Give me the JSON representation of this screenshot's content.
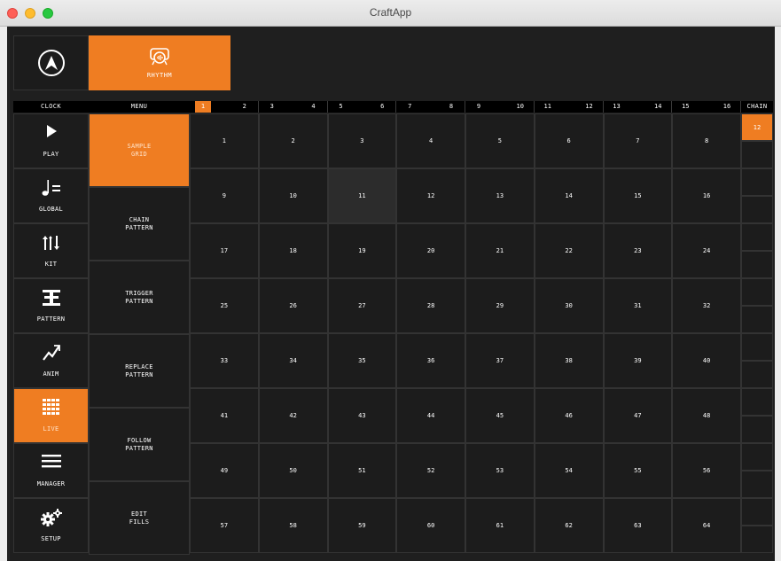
{
  "window": {
    "title": "CraftApp"
  },
  "top": {
    "rhythm_label": "RHYTHM"
  },
  "header": {
    "clock": "CLOCK",
    "menu": "MENU",
    "chain": "CHAIN"
  },
  "sequence": [
    [
      "1",
      "2"
    ],
    [
      "3",
      "4"
    ],
    [
      "5",
      "6"
    ],
    [
      "7",
      "8"
    ],
    [
      "9",
      "10"
    ],
    [
      "11",
      "12"
    ],
    [
      "13",
      "14"
    ],
    [
      "15",
      "16"
    ]
  ],
  "sequence_active": "1",
  "left_nav": [
    {
      "label": "PLAY",
      "icon": "play-icon"
    },
    {
      "label": "GLOBAL",
      "icon": "tempo-icon"
    },
    {
      "label": "KIT",
      "icon": "kit-icon"
    },
    {
      "label": "PATTERN",
      "icon": "pattern-icon"
    },
    {
      "label": "ANIM",
      "icon": "anim-icon"
    },
    {
      "label": "LIVE",
      "icon": "grid-icon",
      "active": true
    },
    {
      "label": "MANAGER",
      "icon": "list-icon"
    },
    {
      "label": "SETUP",
      "icon": "gear-icon"
    }
  ],
  "menu": [
    {
      "label": "SAMPLE\nGRID",
      "active": true
    },
    {
      "label": "CHAIN\nPATTERN"
    },
    {
      "label": "TRIGGER\nPATTERN"
    },
    {
      "label": "REPLACE\nPATTERN"
    },
    {
      "label": "FOLLOW\nPATTERN"
    },
    {
      "label": "EDIT\nFILLS"
    }
  ],
  "grid_cells": [
    "1",
    "2",
    "3",
    "4",
    "5",
    "6",
    "7",
    "8",
    "9",
    "10",
    "11",
    "12",
    "13",
    "14",
    "15",
    "16",
    "17",
    "18",
    "19",
    "20",
    "21",
    "22",
    "23",
    "24",
    "25",
    "26",
    "27",
    "28",
    "29",
    "30",
    "31",
    "32",
    "33",
    "34",
    "35",
    "36",
    "37",
    "38",
    "39",
    "40",
    "41",
    "42",
    "43",
    "44",
    "45",
    "46",
    "47",
    "48",
    "49",
    "50",
    "51",
    "52",
    "53",
    "54",
    "55",
    "56",
    "57",
    "58",
    "59",
    "60",
    "61",
    "62",
    "63",
    "64"
  ],
  "grid_highlight": "11",
  "chain": [
    "12",
    "",
    "",
    "",
    "",
    "",
    "",
    "",
    "",
    "",
    "",
    "",
    "",
    "",
    "",
    ""
  ],
  "colors": {
    "accent": "#ef7d22",
    "background": "#1f1f1f"
  }
}
